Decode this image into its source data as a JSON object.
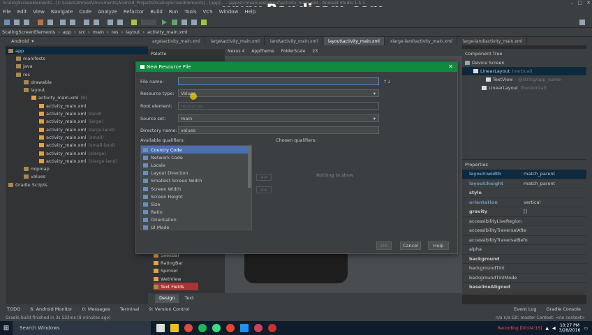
{
  "title_bar": {
    "text": "ScalingScreenElements - [C:\\Users\\Ahmed\\Documents\\Android_Projects\\ScalingScreenElements] - [app] - ...\\app\\src\\main\\res\\layout\\activity_main.xml - Android Studio 1.5.1"
  },
  "watermark": "www.Bandicam.com",
  "menu": [
    "File",
    "Edit",
    "View",
    "Navigate",
    "Code",
    "Analyze",
    "Refactor",
    "Build",
    "Run",
    "Tools",
    "VCS",
    "Window",
    "Help"
  ],
  "breadcrumb": [
    "ScalingScreenElements",
    "app",
    "src",
    "main",
    "res",
    "layout",
    "activity_main.xml"
  ],
  "project_view": "Android",
  "editor_tabs": [
    "arge\\activity_main.xml",
    "large\\activity_main.xml",
    "land\\activity_main.xml",
    "layout\\activity_main.xml",
    "xlarge-land\\activity_main.xml",
    "large-land\\activity_main.xml"
  ],
  "tree": [
    {
      "label": "app",
      "qual": "",
      "depth": 0
    },
    {
      "label": "manifests",
      "qual": "",
      "depth": 1
    },
    {
      "label": "java",
      "qual": "",
      "depth": 1
    },
    {
      "label": "res",
      "qual": "",
      "depth": 1
    },
    {
      "label": "drawable",
      "qual": "",
      "depth": 2
    },
    {
      "label": "layout",
      "qual": "",
      "depth": 2
    },
    {
      "label": "activity_main.xml",
      "qual": "(8)",
      "depth": 3
    },
    {
      "label": "activity_main.xml",
      "qual": "",
      "depth": 4
    },
    {
      "label": "activity_main.xml",
      "qual": "(land)",
      "depth": 4
    },
    {
      "label": "activity_main.xml",
      "qual": "(large)",
      "depth": 4
    },
    {
      "label": "activity_main.xml",
      "qual": "(large-land)",
      "depth": 4
    },
    {
      "label": "activity_main.xml",
      "qual": "(small)",
      "depth": 4
    },
    {
      "label": "activity_main.xml",
      "qual": "(small-land)",
      "depth": 4
    },
    {
      "label": "activity_main.xml",
      "qual": "(xlarge)",
      "depth": 4
    },
    {
      "label": "activity_main.xml",
      "qual": "(xlarge-land)",
      "depth": 4
    },
    {
      "label": "mipmap",
      "qual": "",
      "depth": 2
    },
    {
      "label": "values",
      "qual": "",
      "depth": 2
    },
    {
      "label": "Gradle Scripts",
      "qual": "",
      "depth": 0
    }
  ],
  "palette_label": "Palette",
  "palette_items": [
    "SeekBar",
    "RatingBar",
    "Spinner",
    "WebView",
    "Text Fields"
  ],
  "design_toolbar": {
    "device": "Nexus 4",
    "theme": "AppTheme",
    "folder": "FolderScale",
    "api": "23"
  },
  "design_tabs": [
    "Design",
    "Text"
  ],
  "component_tree": {
    "title": "Component Tree",
    "items": [
      {
        "label": "Device Screen",
        "sub": ""
      },
      {
        "label": "LinearLayout",
        "sub": "(vertical)"
      },
      {
        "label": "TextView",
        "sub": "- @string/app_name"
      },
      {
        "label": "LinearLayout",
        "sub": "(horizontal)"
      }
    ]
  },
  "properties": {
    "title": "Properties",
    "rows": [
      {
        "k": "layout:width",
        "v": "match_parent"
      },
      {
        "k": "layout:height",
        "v": "match_parent"
      },
      {
        "k": "style",
        "v": ""
      },
      {
        "k": "orientation",
        "v": "vertical"
      },
      {
        "k": "gravity",
        "v": "[]"
      },
      {
        "k": "accessibilityLiveRegion",
        "v": ""
      },
      {
        "k": "accessibilityTraversalAfte",
        "v": ""
      },
      {
        "k": "accessibilityTraversalBefo",
        "v": ""
      },
      {
        "k": "alpha",
        "v": ""
      },
      {
        "k": "background",
        "v": ""
      },
      {
        "k": "backgroundTint",
        "v": ""
      },
      {
        "k": "backgroundTintMode",
        "v": ""
      },
      {
        "k": "baselineAligned",
        "v": ""
      }
    ]
  },
  "dialog": {
    "title": "New Resource File",
    "fields": [
      {
        "label": "File name:",
        "value": ""
      },
      {
        "label": "Resource type:",
        "value": "Values"
      },
      {
        "label": "Root element:",
        "value": "resources"
      },
      {
        "label": "Source set:",
        "value": "main"
      },
      {
        "label": "Directory name:",
        "value": "values"
      }
    ],
    "available_label": "Available qualifiers:",
    "chosen_label": "Chosen qualifiers:",
    "qualifiers": [
      "Country Code",
      "Network Code",
      "Locale",
      "Layout Direction",
      "Smallest Screen Width",
      "Screen Width",
      "Screen Height",
      "Size",
      "Ratio",
      "Orientation",
      "UI Mode"
    ],
    "nothing": "Nothing to show",
    "add_btn": ">>",
    "remove_btn": "<<",
    "ok": "OK",
    "cancel": "Cancel",
    "help": "Help"
  },
  "tool_windows": [
    "TODO",
    "6: Android Monitor",
    "0: Messages",
    "Terminal",
    "9: Version Control"
  ],
  "tool_windows_right": [
    "Event Log",
    "Gradle Console"
  ],
  "status": {
    "left": "Gradle build finished in 3s 532ms (8 minutes ago)",
    "right": "n/a   n/a   Git: master   Context: <no context>"
  },
  "taskbar": {
    "search": "Search Windows",
    "recording": "Recording [00:04:15]",
    "time": "10:27 PM",
    "date": "3/28/2016"
  }
}
